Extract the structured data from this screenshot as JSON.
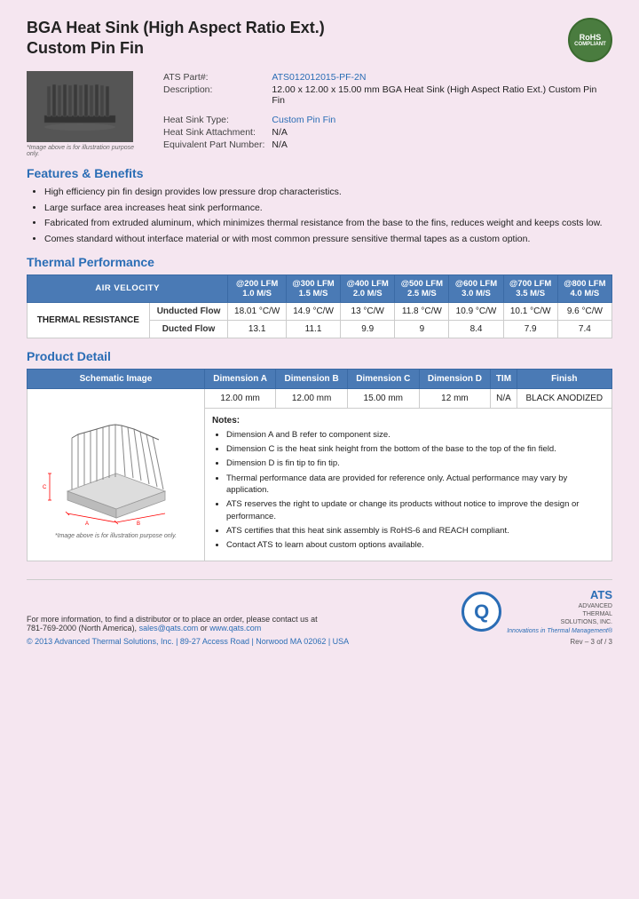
{
  "header": {
    "title_line1": "BGA Heat Sink (High Aspect Ratio Ext.)",
    "title_line2": "Custom Pin Fin",
    "rohs": "RoHS\nCompliant"
  },
  "product_info": {
    "ats_part_label": "ATS Part#:",
    "ats_part_value": "ATS012012015-PF-2N",
    "description_label": "Description:",
    "description_value": "12.00 x 12.00 x 15.00 mm BGA Heat Sink (High Aspect Ratio Ext.) Custom Pin Fin",
    "heat_sink_type_label": "Heat Sink Type:",
    "heat_sink_type_value": "Custom Pin Fin",
    "heat_sink_attachment_label": "Heat Sink Attachment:",
    "heat_sink_attachment_value": "N/A",
    "equivalent_part_label": "Equivalent Part Number:",
    "equivalent_part_value": "N/A",
    "image_caption": "*Image above is for illustration purpose only."
  },
  "features": {
    "title": "Features & Benefits",
    "items": [
      "High efficiency pin fin design provides low pressure drop characteristics.",
      "Large surface area increases heat sink performance.",
      "Fabricated from extruded aluminum, which minimizes thermal resistance from the base to the fins, reduces weight and keeps costs low.",
      "Comes standard without interface material or with most common pressure sensitive thermal tapes as a custom option."
    ]
  },
  "thermal_performance": {
    "title": "Thermal Performance",
    "col_air_velocity": "AIR VELOCITY",
    "columns": [
      "@200 LFM\n1.0 M/S",
      "@300 LFM\n1.5 M/S",
      "@400 LFM\n2.0 M/S",
      "@500 LFM\n2.5 M/S",
      "@600 LFM\n3.0 M/S",
      "@700 LFM\n3.5 M/S",
      "@800 LFM\n4.0 M/S"
    ],
    "row_label": "THERMAL RESISTANCE",
    "unducted_label": "Unducted Flow",
    "ducted_label": "Ducted Flow",
    "unducted_values": [
      "18.01 °C/W",
      "14.9 °C/W",
      "13 °C/W",
      "11.8 °C/W",
      "10.9 °C/W",
      "10.1 °C/W",
      "9.6 °C/W"
    ],
    "ducted_values": [
      "13.1",
      "11.1",
      "9.9",
      "9",
      "8.4",
      "7.9",
      "7.4"
    ]
  },
  "product_detail": {
    "title": "Product Detail",
    "columns": [
      "Schematic Image",
      "Dimension A",
      "Dimension B",
      "Dimension C",
      "Dimension D",
      "TIM",
      "Finish"
    ],
    "dim_a": "12.00 mm",
    "dim_b": "12.00 mm",
    "dim_c": "15.00 mm",
    "dim_d": "12 mm",
    "tim": "N/A",
    "finish": "BLACK ANODIZED",
    "notes_title": "Notes:",
    "notes": [
      "Dimension A and B refer to component size.",
      "Dimension C is the heat sink height from the bottom of the base to the top of the fin field.",
      "Dimension D is fin tip to fin tip.",
      "Thermal performance data are provided for reference only. Actual performance may vary by application.",
      "ATS reserves the right to update or change its products without notice to improve the design or performance.",
      "ATS certifies that this heat sink assembly is RoHS-6 and REACH compliant.",
      "Contact ATS to learn about custom options available."
    ],
    "schematic_caption": "*Image above is for illustration purpose only."
  },
  "footer": {
    "contact_text": "For more information, to find a distributor or to place an order, please contact us at",
    "phone": "781-769-2000 (North America),",
    "email": "sales@qats.com",
    "email_or": " or ",
    "website": "www.qats.com",
    "copyright": "© 2013 Advanced Thermal Solutions, Inc. | 89-27 Access Road | Norwood MA  02062 | USA",
    "ats_q": "Q",
    "ats_name": "ATS",
    "ats_full1": "ADVANCED",
    "ats_full2": "THERMAL",
    "ats_full3": "SOLUTIONS, INC.",
    "ats_tagline": "Innovations in Thermal Management®",
    "page_num": "Rev – 3 of / 3"
  }
}
